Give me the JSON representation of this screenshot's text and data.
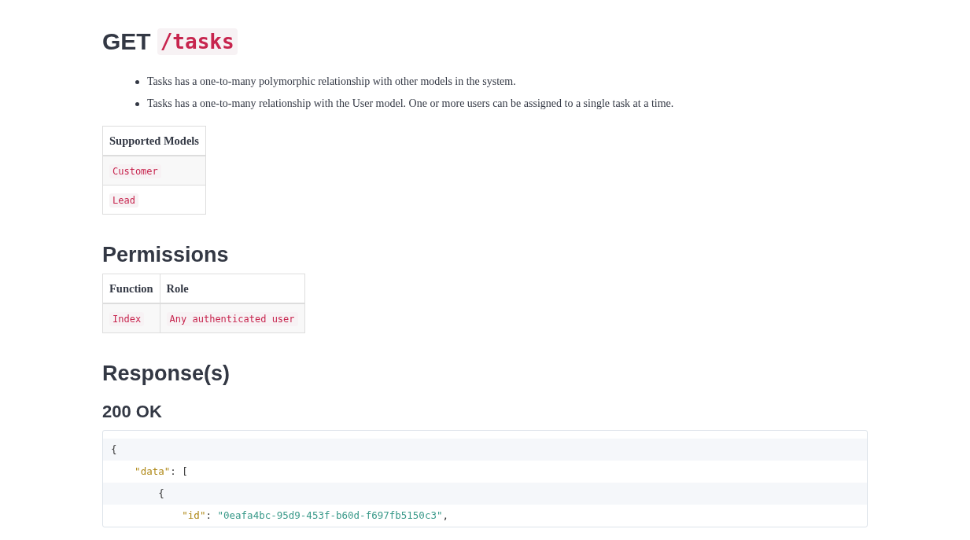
{
  "title": {
    "method": "GET",
    "path": "/tasks"
  },
  "notes": [
    "Tasks has a one-to-many polymorphic relationship with other models in the system.",
    "Tasks has a one-to-many relationship with the User model. One or more users can be assigned to a single task at a time."
  ],
  "models_table": {
    "columns": [
      "Supported Models"
    ],
    "rows": [
      [
        "Customer"
      ],
      [
        "Lead"
      ]
    ]
  },
  "permissions": {
    "heading": "Permissions",
    "columns": [
      "Function",
      "Role"
    ],
    "rows": [
      [
        "Index",
        "Any authenticated user"
      ]
    ]
  },
  "responses": {
    "heading": "Response(s)",
    "status": "200 OK",
    "code_lines": [
      [
        {
          "kind": "punct",
          "text": "{"
        }
      ],
      [
        {
          "kind": "key",
          "text": "    \"data\""
        },
        {
          "kind": "punct",
          "text": ": ["
        }
      ],
      [
        {
          "kind": "punct",
          "text": "        {"
        }
      ],
      [
        {
          "kind": "key",
          "text": "            \"id\""
        },
        {
          "kind": "punct",
          "text": ": "
        },
        {
          "kind": "string",
          "text": "\"0eafa4bc-95d9-453f-b60d-f697fb5150c3\""
        },
        {
          "kind": "punct",
          "text": ","
        }
      ]
    ]
  }
}
